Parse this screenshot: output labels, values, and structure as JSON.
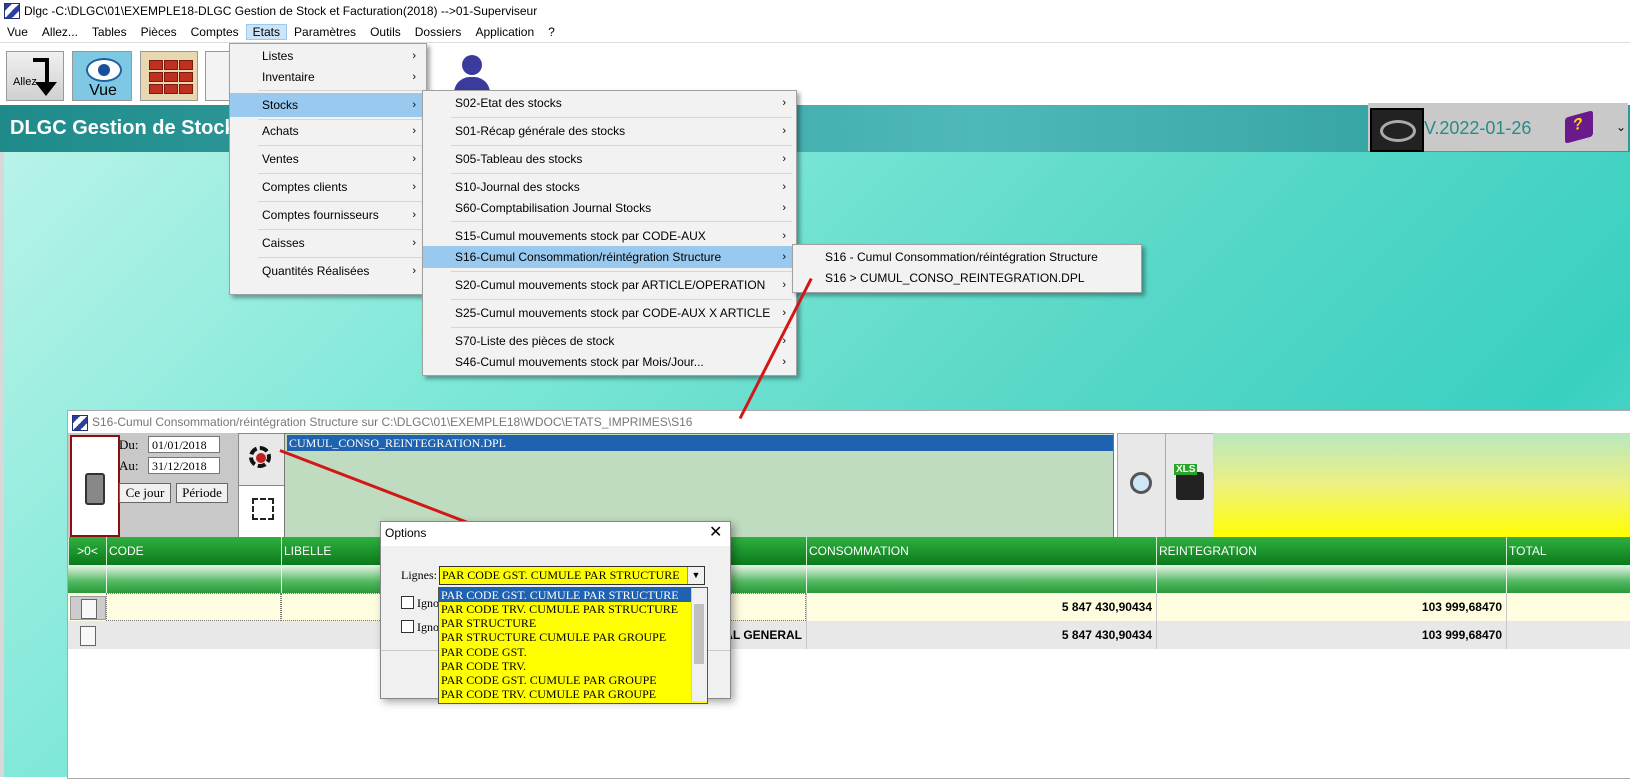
{
  "window_title": "Dlgc -C:\\DLGC\\01\\EXEMPLE18-DLGC Gestion de Stock et Facturation(2018) -->01-Superviseur",
  "menubar": [
    "Vue",
    "Allez...",
    "Tables",
    "Pièces",
    "Comptes",
    "Etats",
    "Paramètres",
    "Outils",
    "Dossiers",
    "Application",
    "?"
  ],
  "toolbar": {
    "allez_label": "Allez...",
    "vue_label": "Vue"
  },
  "banner": {
    "title": "DLGC Gestion de Stock",
    "version": "V.2022-01-26"
  },
  "etats_menu": [
    {
      "label": "Listes"
    },
    {
      "label": "Inventaire"
    },
    {
      "label": "Stocks"
    },
    {
      "label": "Achats"
    },
    {
      "label": "Ventes"
    },
    {
      "label": "Comptes clients"
    },
    {
      "label": "Comptes fournisseurs"
    },
    {
      "label": "Caisses"
    },
    {
      "label": "Quantités Réalisées"
    }
  ],
  "stocks_menu": [
    {
      "label": "S02-Etat des stocks"
    },
    {
      "label": "S01-Récap générale des stocks"
    },
    {
      "label": "S05-Tableau des stocks"
    },
    {
      "label": "S10-Journal des stocks"
    },
    {
      "label": "S60-Comptabilisation Journal Stocks"
    },
    {
      "label": "S15-Cumul mouvements stock par CODE-AUX"
    },
    {
      "label": "S16-Cumul Consommation/réintégration Structure"
    },
    {
      "label": "S20-Cumul mouvements stock par ARTICLE/OPERATION"
    },
    {
      "label": "S25-Cumul mouvements stock par CODE-AUX X ARTICLE"
    },
    {
      "label": "S70-Liste des pièces de stock"
    },
    {
      "label": "S46-Cumul mouvements stock par Mois/Jour..."
    }
  ],
  "s16_menu": [
    {
      "label": "S16 - Cumul Consommation/réintégration Structure"
    },
    {
      "label": "S16 > CUMUL_CONSO_REINTEGRATION.DPL"
    }
  ],
  "s16_window": {
    "title": "S16-Cumul Consommation/réintégration Structure sur C:\\DLGC\\01\\EXEMPLE18\\WDOC\\ETATS_IMPRIMES\\S16",
    "du_label": "Du:",
    "du_value": "01/01/2018",
    "au_label": "Au:",
    "au_value": "31/12/2018",
    "ce_jour": "Ce jour",
    "periode": "Période",
    "file_item": "CUMUL_CONSO_REINTEGRATION.DPL",
    "xls_label": "XLS"
  },
  "table": {
    "headers": [
      ">0<",
      "CODE",
      "LIBELLE",
      "CONSOMMATION",
      "REINTEGRATION",
      "TOTAL"
    ],
    "row1": {
      "consommation": "5 847 430,90434",
      "reintegration": "103 999,68470"
    },
    "row2": {
      "libelle": "AL GENERAL",
      "consommation": "5 847 430,90434",
      "reintegration": "103 999,68470"
    }
  },
  "options_dialog": {
    "title": "Options",
    "close": "✕",
    "lignes_label": "Lignes:",
    "selected": "PAR CODE GST. CUMULE PAR STRUCTURE",
    "checkbox1": "Igno",
    "checkbox2": "Igno",
    "options": [
      "PAR CODE GST. CUMULE PAR STRUCTURE",
      "PAR CODE TRV. CUMULE PAR STRUCTURE",
      "PAR STRUCTURE",
      "PAR STRUCTURE CUMULE PAR GROUPE",
      "PAR CODE GST.",
      "PAR CODE TRV.",
      "PAR CODE GST. CUMULE PAR GROUPE",
      "PAR CODE TRV. CUMULE PAR GROUPE"
    ]
  },
  "colors": {
    "highlight": "#99c9ef",
    "select_blue": "#1f63b0",
    "yellow": "#ffff00",
    "header_green": "#0a7a1a",
    "annotation_red": "#d01818"
  }
}
